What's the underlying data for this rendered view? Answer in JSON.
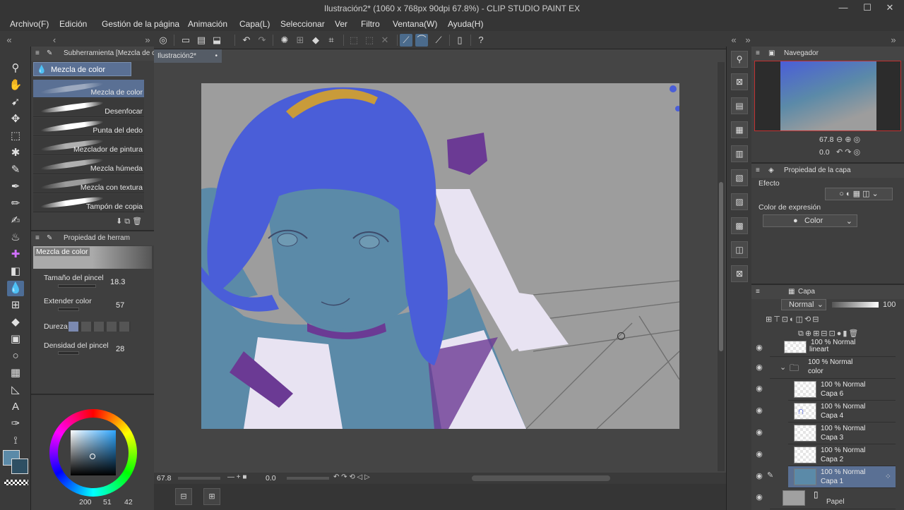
{
  "window": {
    "title": "Ilustración2* (1060 x 768px 90dpi 67.8%) - CLIP STUDIO PAINT EX",
    "minimize": "—",
    "maximize": "☐",
    "close": "✕"
  },
  "menu": [
    "Archivo(F)",
    "Edición",
    "Gestión de la página",
    "Animación",
    "Capa(L)",
    "Seleccionar",
    "Ver",
    "Filtro",
    "Ventana(W)",
    "Ayuda(H)"
  ],
  "subtool": {
    "header": "Subherramienta [Mezcla de co",
    "group_tab": "Mezcla de color",
    "brushes": [
      {
        "label": "Mezcla de color"
      },
      {
        "label": "Desenfocar"
      },
      {
        "label": "Punta del dedo"
      },
      {
        "label": "Mezclador de pintura"
      },
      {
        "label": "Mezcla húmeda"
      },
      {
        "label": "Mezcla con textura"
      },
      {
        "label": "Tampón de copia"
      }
    ]
  },
  "tool_property": {
    "header": "Propiedad de herram",
    "tool_name": "Mezcla de color",
    "rows": [
      {
        "label": "Tamaño del pincel",
        "value": "18.3"
      },
      {
        "label": "Extender color",
        "value": "57"
      },
      {
        "label": "Dureza",
        "value": ""
      },
      {
        "label": "Densidad del pincel",
        "value": "28"
      }
    ]
  },
  "color": {
    "main": "#5b8aa8",
    "sub": "#2e4f63",
    "values": [
      "200",
      "51",
      "42"
    ]
  },
  "document": {
    "tab_label": "Ilustración2*",
    "zoom": "67.8",
    "rotation": "0.0"
  },
  "navigator": {
    "header": "Navegador",
    "zoom": "67.8",
    "rotation": "0.0"
  },
  "layer_property": {
    "header": "Propiedad de la capa",
    "effect_label": "Efecto",
    "expression_label": "Color de expresión",
    "expression_value": "Color"
  },
  "layers_panel": {
    "header": "Capa",
    "blend_mode": "Normal",
    "opacity": "100",
    "layers": [
      {
        "line1": "100 % Normal",
        "line2": "lineart"
      },
      {
        "line1": "100 % Normal",
        "line2": "color"
      },
      {
        "line1": "100 % Normal",
        "line2": "Capa 6"
      },
      {
        "line1": "100 % Normal",
        "line2": "Capa 4"
      },
      {
        "line1": "100 % Normal",
        "line2": "Capa 3"
      },
      {
        "line1": "100 % Normal",
        "line2": "Capa 2"
      },
      {
        "line1": "100 % Normal",
        "line2": "Capa 1"
      },
      {
        "line1": "",
        "line2": "Papel"
      }
    ]
  }
}
